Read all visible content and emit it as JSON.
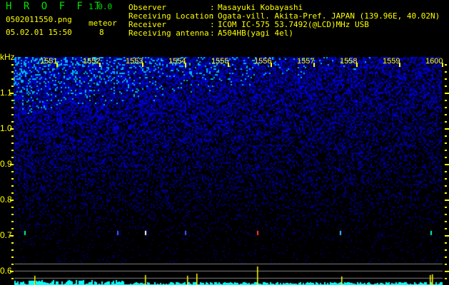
{
  "app": {
    "name_letters": "H R O F F T",
    "version": "1.0.0"
  },
  "file": {
    "name": "0502011550.png",
    "datetime": "05.02.01 15:50"
  },
  "meteor": {
    "label": "meteor",
    "count": "8"
  },
  "info": {
    "observer_label": "Observer",
    "observer": "Masayuki Kobayashi",
    "location_label": "Receiving Location",
    "location": "Ogata-vill. Akita-Pref. JAPAN (139.96E, 40.02N)",
    "receiver_label": "Receiver",
    "receiver": "ICOM IC-575 53.7492(@LCD)MHz USB",
    "antenna_label": "Receiving antenna",
    "antenna": "A504HB(yagi 4el)",
    "sep": ":"
  },
  "axis": {
    "unit": "kHz",
    "time_labels": [
      "1551",
      "1552",
      "1553",
      "1554",
      "1555",
      "1556",
      "1557",
      "1558",
      "1559",
      "1600"
    ],
    "freq_labels": [
      "1.1",
      "1.0",
      "0.9",
      "0.8",
      "0.7",
      "0.6"
    ]
  },
  "colors": {
    "yellow": "#ffff00",
    "green": "#00e000",
    "cyan": "#00ffff",
    "noise": "#1020ff"
  }
}
